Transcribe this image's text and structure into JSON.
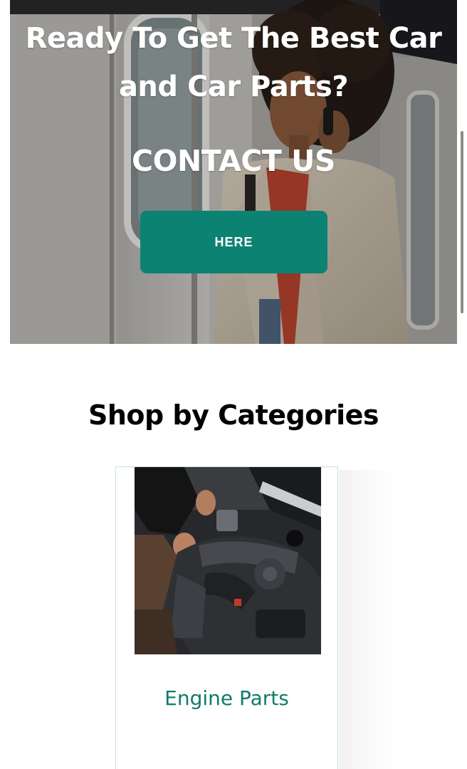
{
  "hero": {
    "title": "Ready To Get The Best Car and Car Parts?",
    "contact_heading": "CONTACT US",
    "button_label": "HERE"
  },
  "categories": {
    "heading": "Shop by Categories",
    "items": [
      {
        "label": "Engine Parts",
        "image": "engine-bay-photo"
      }
    ]
  },
  "colors": {
    "accent": "#0c8273",
    "category_text": "#137a6b",
    "card_border": "#c5e6d9"
  }
}
